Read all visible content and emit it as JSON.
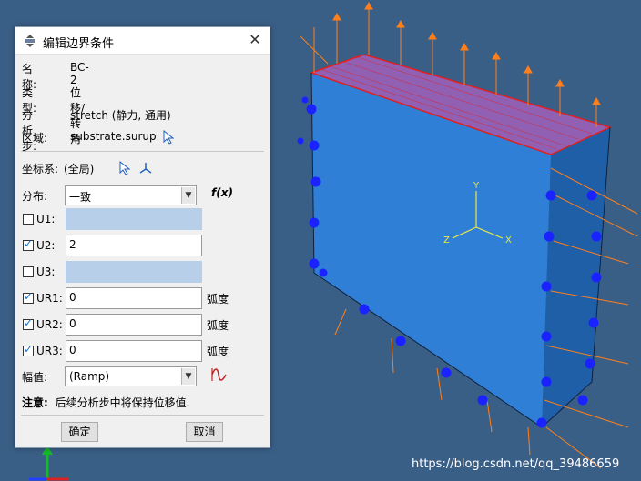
{
  "dialog": {
    "title": "编辑边界条件",
    "name_label": "名称:",
    "name_value": "BC-2",
    "type_label": "类型:",
    "type_value": "位移/转角",
    "step_label": "分析步:",
    "step_value": "stretch (静力, 通用)",
    "region_label": "区域:",
    "region_value": "substrate.surup",
    "csys_label": "坐标系:",
    "csys_value": "(全局)",
    "distribution_label": "分布:",
    "distribution_value": "一致",
    "fx_label": "f(x)",
    "amplitude_label": "幅值:",
    "amplitude_value": "(Ramp)",
    "note_label": "注意:",
    "note_text": "后续分析步中将保持位移值.",
    "ok_label": "确定",
    "cancel_label": "取消"
  },
  "dofs": [
    {
      "label": "U1:",
      "checked": false,
      "value": "",
      "unit": ""
    },
    {
      "label": "U2:",
      "checked": true,
      "value": "2",
      "unit": ""
    },
    {
      "label": "U3:",
      "checked": false,
      "value": "",
      "unit": ""
    },
    {
      "label": "UR1:",
      "checked": true,
      "value": "0",
      "unit": "弧度"
    },
    {
      "label": "UR2:",
      "checked": true,
      "value": "0",
      "unit": "弧度"
    },
    {
      "label": "UR3:",
      "checked": true,
      "value": "0",
      "unit": "弧度"
    }
  ],
  "viewport": {
    "axis_labels": {
      "y": "Y",
      "x": "X",
      "z": "Z"
    },
    "watermark": "https://blog.csdn.net/qq_39486659",
    "colors": {
      "background": "#3a5f87",
      "face_front": "#2f7fd6",
      "face_side": "#1f5fa8",
      "face_top": "#b060c0",
      "arrows_orange": "#ff7f1a",
      "arrows_blue": "#1a22ff",
      "triad": "#e8e84a"
    }
  }
}
